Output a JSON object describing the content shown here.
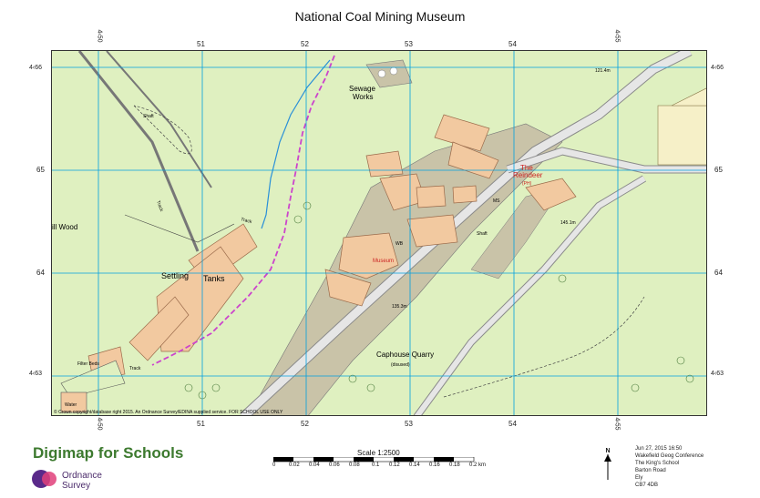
{
  "title": "National Coal Mining Museum",
  "grid": {
    "top_numbers": [
      "51",
      "52",
      "53",
      "54"
    ],
    "top_full_left": "4‹50",
    "top_full_right": "4‹55",
    "left_numbers": [
      "65",
      "64"
    ],
    "left_full_top": "4‹66",
    "left_full_bottom": "4‹63",
    "right_numbers": [
      "65",
      "64"
    ],
    "right_full_top": "4‹66",
    "right_full_bottom": "4‹63"
  },
  "map_labels": {
    "sewage_works_1": "Sewage",
    "sewage_works_2": "Works",
    "settling": "Settling",
    "tanks": "Tanks",
    "ill_wood": "ill Wood",
    "museum": "Museum",
    "the_reindeer": "The",
    "reindeer": "Reindeer",
    "ph": "(PH)",
    "caphouse_quarry": "Caphouse Quarry",
    "disused": "(disused)",
    "shaft_1": "Shaft",
    "shaft_2": "Shaft",
    "ms": "MS",
    "wb": "WB",
    "track_1": "Track",
    "track_2": "Track",
    "track_3": "Track",
    "filter_beds": "Filter Beds",
    "water": "Water",
    "spot_1": "121.4m",
    "spot_2": "145.1m",
    "spot_3": "135.3m",
    "copyright": "© Crown copyright/database right 2015. An Ordnance Survey/EDINA supplied service. FOR SCHOOL USE ONLY"
  },
  "footer": {
    "brand": "Digimap for Schools",
    "os_line1": "Ordnance",
    "os_line2": "Survey",
    "scale_title": "Scale 1:2500",
    "scale_ticks": [
      "0",
      "0.02",
      "0.04",
      "0.06",
      "0.08",
      "0.1",
      "0.12",
      "0.14",
      "0.16",
      "0.18",
      "0.2 km"
    ],
    "north": "N",
    "date": "Jun 27, 2015 16:50",
    "line2": "Wakefield Geog Conference",
    "line3": "The King's School",
    "line4": "Barton Road",
    "line5": "Ely",
    "line6": "CB7 4DB"
  },
  "colors": {
    "grass": "#dff0c0",
    "grass_dark": "#cfe7a8",
    "building": "#f2c9a0",
    "building_outline": "#9a6a4a",
    "grid": "#00a0e0",
    "path": "#cc44cc",
    "road": "#bdbdbd",
    "industrial": "#c9c3a8",
    "brand_green": "#3d7a2f",
    "os_purple": "#5a2a8a"
  }
}
